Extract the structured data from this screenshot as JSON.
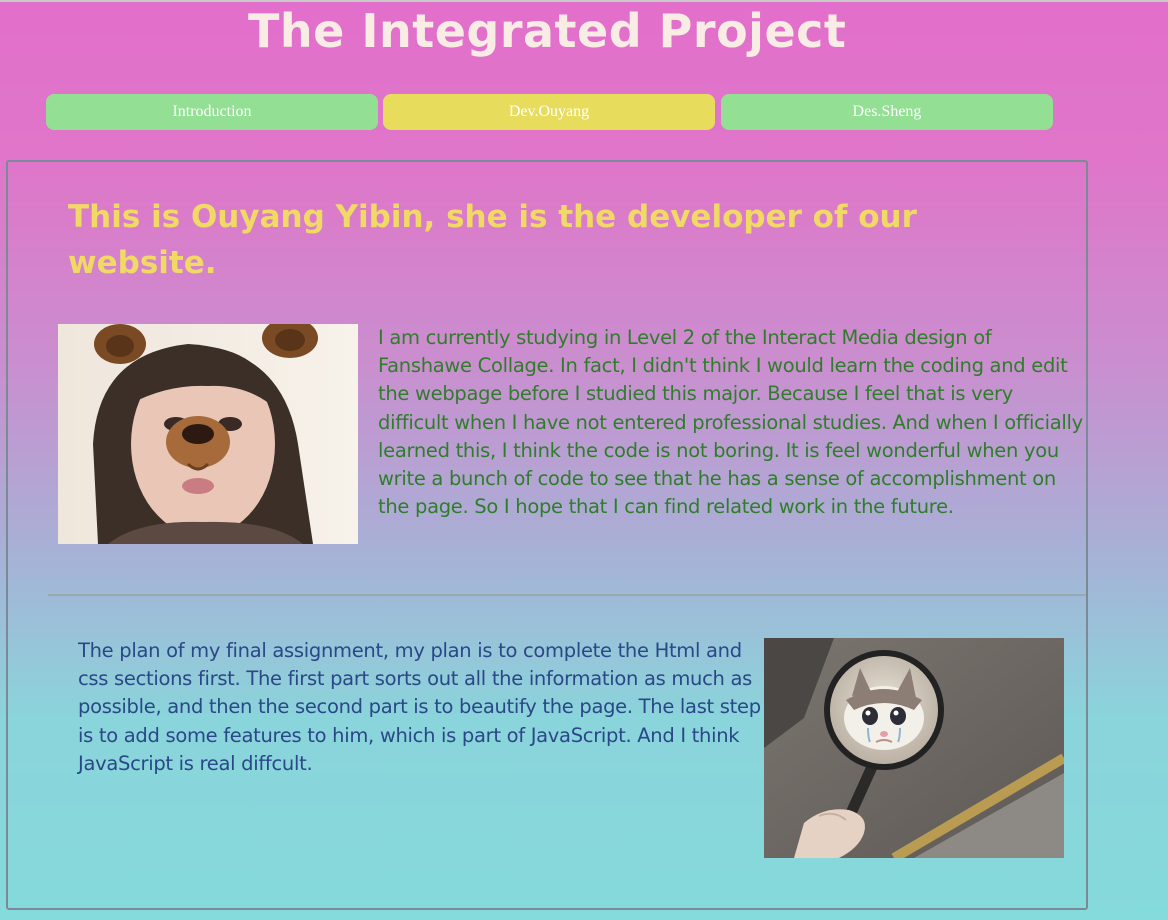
{
  "header": {
    "title": "The Integrated Project"
  },
  "nav": {
    "tabs": [
      {
        "label": "Introduction",
        "active": false
      },
      {
        "label": "Dev.Ouyang",
        "active": true
      },
      {
        "label": "Des.Sheng",
        "active": false
      }
    ]
  },
  "main": {
    "headline": "This is Ouyang Yibin, she is the developer of our website.",
    "bio": "I am currently studying in Level 2 of the Interact Media design of Fanshawe Collage. In fact, I didn't think I would learn the coding and edit the webpage before I studied this major. Because I feel that is very difficult when I have not entered professional studies. And when I officially learned this, I think the code is not boring. It is feel wonderful when you write a bunch of code to see that he has a sense of accomplishment on the page. So I hope that I can find related work in the future.",
    "plan": "The plan of my final assignment, my plan is to complete the Html and css sections first. The first part sorts out all the information as much as possible, and then the second part is to beautify the page. The last step is to add some features to him, which is part of JavaScript. And I think JavaScript is real diffcult."
  },
  "colors": {
    "title_text": "#f8ece4",
    "tab_default": "#93df94",
    "tab_active": "#e8dc5d",
    "headline_text": "#f1d965",
    "bio_text": "#2f7d2a",
    "plan_text": "#2a4787"
  }
}
